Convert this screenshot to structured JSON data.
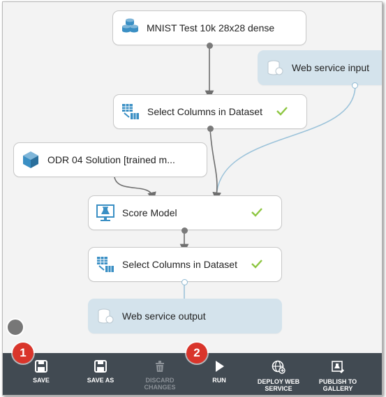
{
  "canvas": {
    "modules": {
      "dataset": {
        "label": "MNIST Test 10k 28x28 dense",
        "icon": "dataset-icon"
      },
      "web_input": {
        "label": "Web service input",
        "icon": "web-service-icon"
      },
      "select1": {
        "label": "Select Columns in Dataset",
        "icon": "select-columns-icon",
        "status": "checkmark-icon"
      },
      "trained": {
        "label": "ODR 04 Solution [trained m...",
        "icon": "trained-model-icon"
      },
      "score": {
        "label": "Score Model",
        "icon": "score-model-icon",
        "status": "checkmark-icon"
      },
      "select2": {
        "label": "Select Columns in Dataset",
        "icon": "select-columns-icon",
        "status": "checkmark-icon"
      },
      "web_output": {
        "label": "Web service output",
        "icon": "web-service-icon"
      }
    }
  },
  "toolbar": {
    "save": "SAVE",
    "save_as": "SAVE AS",
    "discard": "DISCARD CHANGES",
    "run": "RUN",
    "deploy_line1": "DEPLOY WEB",
    "deploy_line2": "SERVICE",
    "publish_line1": "PUBLISH TO",
    "publish_line2": "GALLERY"
  },
  "callouts": {
    "first": "1",
    "second": "2"
  },
  "colors": {
    "toolbar_bg": "#414a52",
    "canvas_bg": "#f3f3f3",
    "web_node_bg": "#d4e3ec",
    "check_green": "#8dc641",
    "wire_gray": "#6e6e6e",
    "wire_blue": "#9cc3da",
    "callout_red": "#d9352b",
    "icon_blue": "#3a8fc4"
  }
}
